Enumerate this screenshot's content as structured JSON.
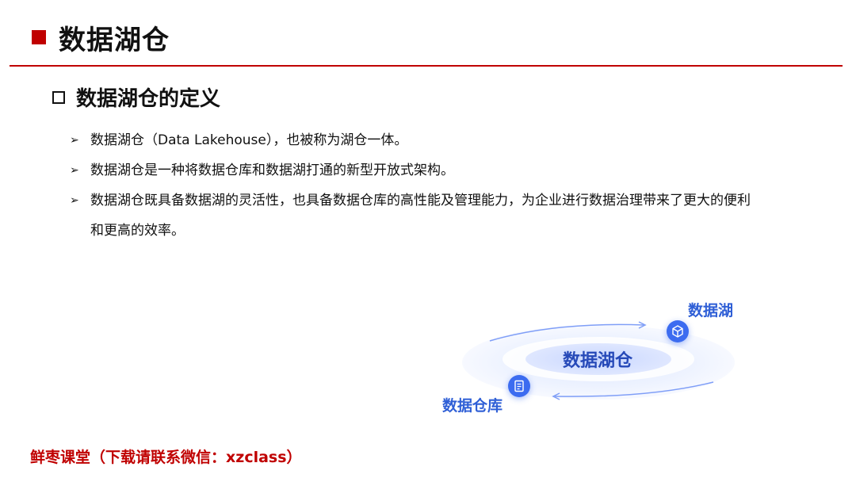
{
  "header": {
    "title": "数据湖仓"
  },
  "section": {
    "title": "数据湖仓的定义"
  },
  "bullets": [
    {
      "text": "数据湖仓（Data Lakehouse），也被称为湖仓一体。"
    },
    {
      "text": "数据湖仓是一种将数据仓库和数据湖打通的新型开放式架构。"
    },
    {
      "text": "数据湖仓既具备数据湖的灵活性，也具备数据仓库的高性能及管理能力，为企业进行数据治理带来了更大的便利和更高的效率。"
    }
  ],
  "diagram": {
    "center_label": "数据湖仓",
    "lake_label": "数据湖",
    "warehouse_label": "数据仓库",
    "lake_icon": "cube-icon",
    "warehouse_icon": "document-icon",
    "accent_color": "#3c6cf0"
  },
  "footer": {
    "text": "鲜枣课堂（下载请联系微信：xzclass）"
  },
  "colors": {
    "brand_red": "#c00000",
    "diagram_blue": "#2f5fd6"
  }
}
